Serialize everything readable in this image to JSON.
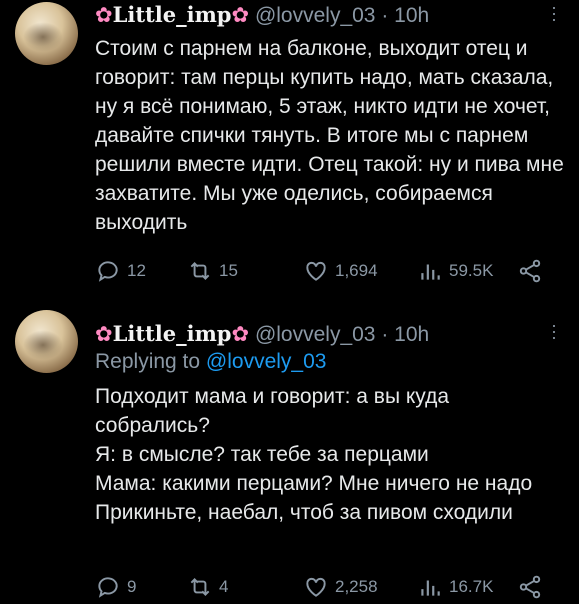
{
  "tweets": [
    {
      "display_name": "Little_imp",
      "handle": "@lovvely_03",
      "separator": "·",
      "time": "10h",
      "body": [
        "Стоим с парнем на балконе, выходит отец и говорит: там перцы купить надо, мать сказала, ну я всё понимаю, 5 этаж, никто идти не хочет, давайте спички тянуть. В итоге мы с парнем решили вместе идти. Отец такой: ну и пива мне захватите. Мы уже оделись, собираемся выходить"
      ],
      "replies": "12",
      "retweets": "15",
      "likes": "1,694",
      "views": "59.5K"
    },
    {
      "display_name": "Little_imp",
      "handle": "@lovvely_03",
      "separator": "·",
      "time": "10h",
      "replying_label": "Replying to",
      "replying_handle": "@lovvely_03",
      "body": [
        "Подходит мама и говорит: а вы куда собрались?",
        "Я: в смысле? так тебе за перцами",
        "Мама: какими перцами? Мне ничего не надо",
        "Прикиньте, наебал, чтоб за пивом сходили"
      ],
      "replies": "9",
      "retweets": "4",
      "likes": "2,258",
      "views": "16.7K"
    }
  ],
  "icons": {
    "flower": "flower-icon",
    "more": "more-vertical-icon",
    "reply": "reply-icon",
    "retweet": "retweet-icon",
    "like": "heart-icon",
    "views": "views-icon",
    "share": "share-icon"
  },
  "colors": {
    "background": "#000000",
    "text": "#e7e9ea",
    "muted": "#8b98a5",
    "link": "#1d9bf0",
    "flower": "#ff8ac2"
  }
}
